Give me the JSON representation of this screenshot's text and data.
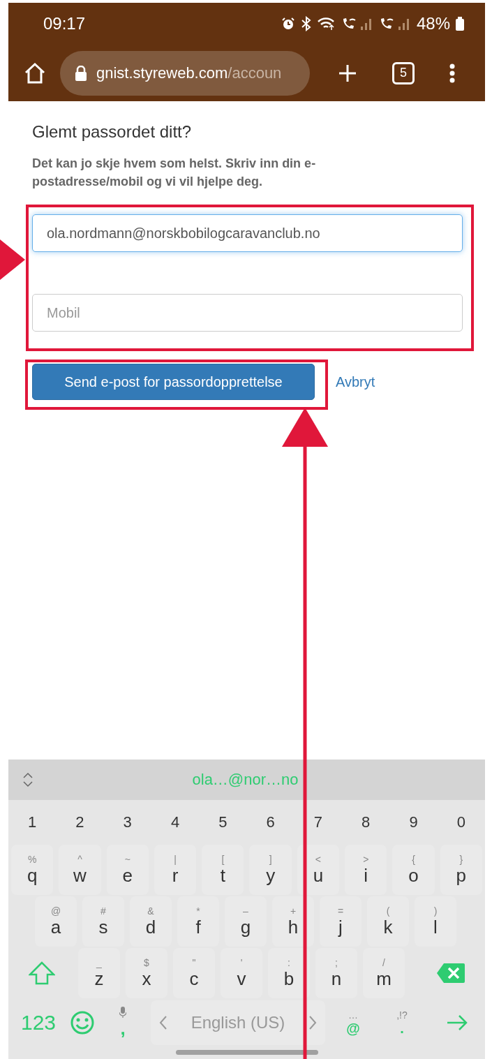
{
  "status_bar": {
    "time": "09:17",
    "battery": "48%"
  },
  "browser": {
    "url_host": "gnist.styreweb.com",
    "url_path": "/accoun",
    "tab_count": "5"
  },
  "page": {
    "title": "Glemt passordet ditt?",
    "description": "Det kan jo skje hvem som helst. Skriv inn din e-postadresse/mobil og vi vil hjelpe deg.",
    "email_field": {
      "value": "ola.nordmann@norskbobilogcaravanclub.no",
      "focused": true
    },
    "mobile_field": {
      "placeholder": "Mobil",
      "focused": false
    },
    "submit_button": "Send e-post for passordopprettelse",
    "cancel_link": "Avbryt"
  },
  "keyboard": {
    "suggestion": "ola…@nor…no",
    "number_row": [
      "1",
      "2",
      "3",
      "4",
      "5",
      "6",
      "7",
      "8",
      "9",
      "0"
    ],
    "letter_rows": [
      [
        {
          "key": "q",
          "alt": "%"
        },
        {
          "key": "w",
          "alt": "^"
        },
        {
          "key": "e",
          "alt": "~"
        },
        {
          "key": "r",
          "alt": "|"
        },
        {
          "key": "t",
          "alt": "["
        },
        {
          "key": "y",
          "alt": "]"
        },
        {
          "key": "u",
          "alt": "<"
        },
        {
          "key": "i",
          "alt": ">"
        },
        {
          "key": "o",
          "alt": "{"
        },
        {
          "key": "p",
          "alt": "}"
        }
      ],
      [
        {
          "key": "a",
          "alt": "@"
        },
        {
          "key": "s",
          "alt": "#"
        },
        {
          "key": "d",
          "alt": "&"
        },
        {
          "key": "f",
          "alt": "*"
        },
        {
          "key": "g",
          "alt": "–"
        },
        {
          "key": "h",
          "alt": "+"
        },
        {
          "key": "j",
          "alt": "="
        },
        {
          "key": "k",
          "alt": "("
        },
        {
          "key": "l",
          "alt": ")"
        }
      ],
      [
        {
          "key": "z",
          "alt": "_"
        },
        {
          "key": "x",
          "alt": "$"
        },
        {
          "key": "c",
          "alt": "\""
        },
        {
          "key": "v",
          "alt": "'"
        },
        {
          "key": "b",
          "alt": ":"
        },
        {
          "key": "n",
          "alt": ";"
        },
        {
          "key": "m",
          "alt": "/"
        }
      ]
    ],
    "bottom_row": {
      "mode_key": "123",
      "comma_key": ",",
      "space_key": "English (US)",
      "at_key": {
        "key": "@",
        "alt": "…"
      },
      "period_key": {
        "key": ".",
        "alt": ",!?"
      }
    }
  }
}
